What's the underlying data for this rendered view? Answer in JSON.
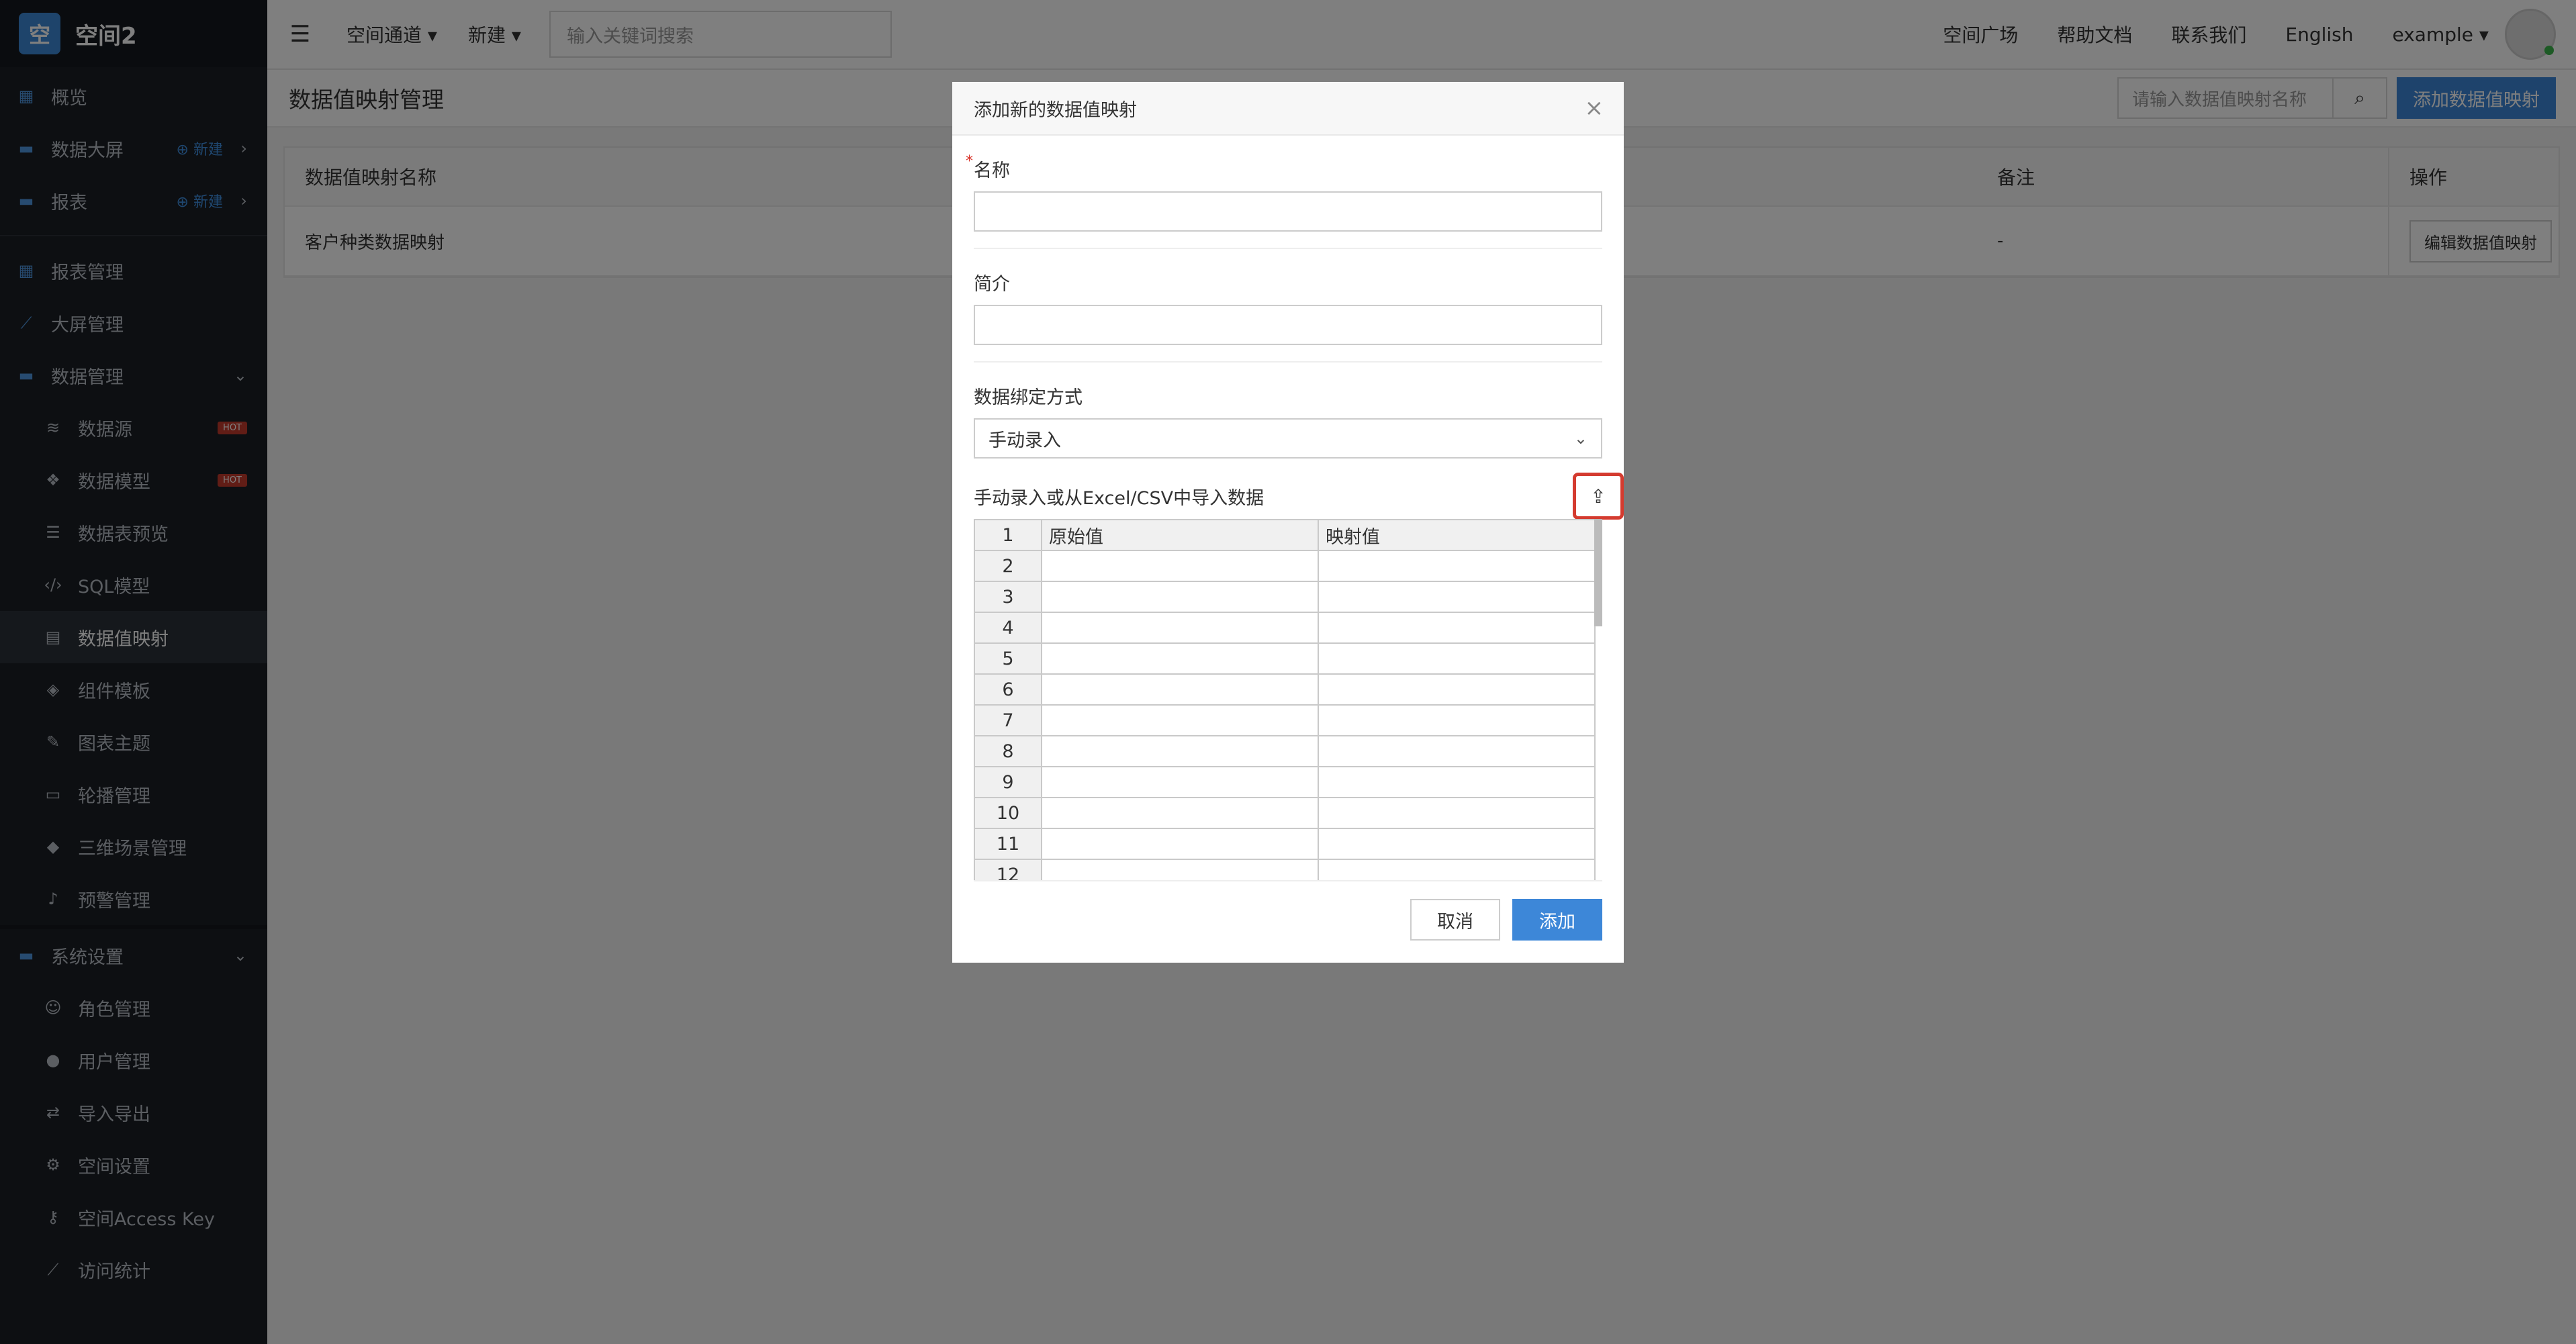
{
  "brand": {
    "logo_char": "空",
    "name": "空间2"
  },
  "sidebar": {
    "items": [
      {
        "label": "概览",
        "icon": "dashboard-icon"
      },
      {
        "label": "数据大屏",
        "icon": "folder-icon",
        "new_label": "新建"
      },
      {
        "label": "报表",
        "icon": "folder-icon",
        "new_label": "新建"
      },
      {
        "label": "报表管理",
        "icon": "grid-icon"
      },
      {
        "label": "大屏管理",
        "icon": "chart-line-icon"
      },
      {
        "label": "数据管理",
        "icon": "folder-icon"
      },
      {
        "label": "数据源",
        "icon": "database-icon",
        "badge": "HOT"
      },
      {
        "label": "数据模型",
        "icon": "cubes-icon",
        "badge": "HOT"
      },
      {
        "label": "数据表预览",
        "icon": "list-icon"
      },
      {
        "label": "SQL模型",
        "icon": "code-icon"
      },
      {
        "label": "数据值映射",
        "icon": "book-icon"
      },
      {
        "label": "组件模板",
        "icon": "dropbox-icon"
      },
      {
        "label": "图表主题",
        "icon": "magic-icon"
      },
      {
        "label": "轮播管理",
        "icon": "desktop-icon"
      },
      {
        "label": "三维场景管理",
        "icon": "cube-icon"
      },
      {
        "label": "预警管理",
        "icon": "bell-icon"
      },
      {
        "label": "系统设置",
        "icon": "folder-icon"
      },
      {
        "label": "角色管理",
        "icon": "users-icon"
      },
      {
        "label": "用户管理",
        "icon": "user-icon"
      },
      {
        "label": "导入导出",
        "icon": "exchange-icon"
      },
      {
        "label": "空间设置",
        "icon": "gear-icon"
      },
      {
        "label": "空间Access Key",
        "icon": "key-icon"
      },
      {
        "label": "访问统计",
        "icon": "chart-area-icon"
      }
    ]
  },
  "topbar": {
    "channel_label": "空间通道",
    "new_label": "新建",
    "search_placeholder": "输入关键词搜索",
    "links": [
      "空间广场",
      "帮助文档",
      "联系我们",
      "English"
    ],
    "user": "example"
  },
  "page": {
    "title": "数据值映射管理",
    "search_placeholder": "请输入数据值映射名称",
    "add_button": "添加数据值映射",
    "table": {
      "headers": [
        "数据值映射名称",
        "备注",
        "操作"
      ],
      "rows": [
        {
          "name": "客户种类数据映射",
          "note": "-",
          "action": "编辑数据值映射"
        }
      ]
    }
  },
  "modal": {
    "title": "添加新的数据值映射",
    "name_label": "名称",
    "required_mark": "*",
    "desc_label": "简介",
    "binding_label": "数据绑定方式",
    "binding_value": "手动录入",
    "import_label": "手动录入或从Excel/CSV中导入数据",
    "grid": {
      "headers": [
        "原始值",
        "映射值"
      ],
      "row_numbers": [
        "1",
        "2",
        "3",
        "4",
        "5",
        "6",
        "7",
        "8",
        "9",
        "10",
        "11",
        "12"
      ]
    },
    "cancel_label": "取消",
    "ok_label": "添加"
  }
}
